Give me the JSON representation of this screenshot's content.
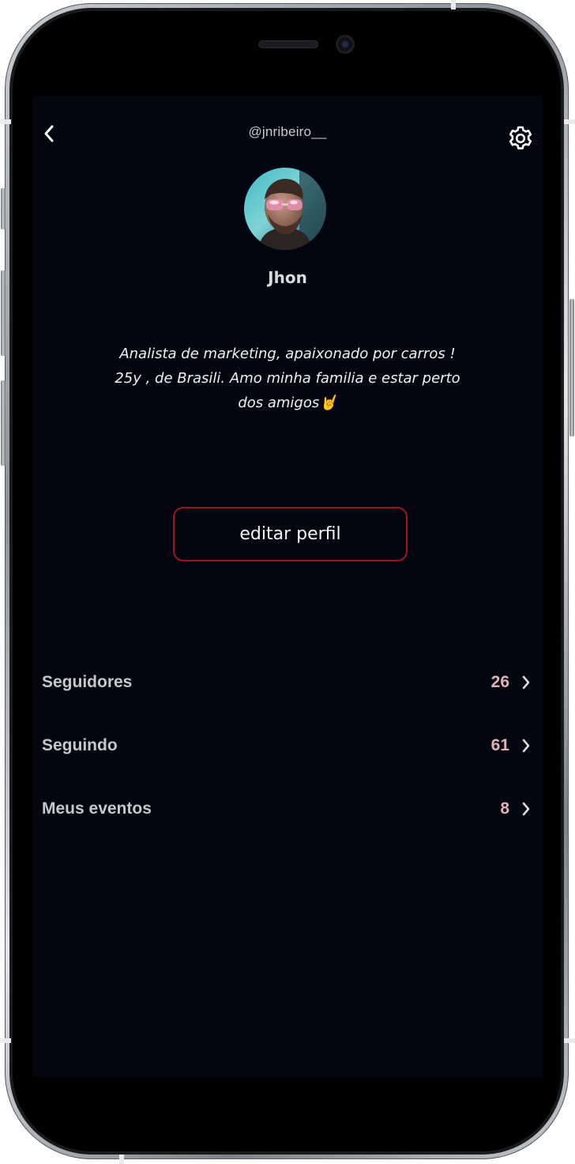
{
  "header": {
    "username": "@jnribeiro__",
    "back_icon": "chevron-left-icon",
    "settings_icon": "gear-icon"
  },
  "profile": {
    "name": "Jhon",
    "avatar_icon": "user-avatar",
    "bio_lines": [
      "Analista de marketing, apaixonado por carros !",
      "25y , de Brasili. Amo minha familia e estar perto",
      "dos amigos🤘"
    ],
    "edit_button_label": "editar perfil"
  },
  "stats": [
    {
      "label": "Seguidores",
      "count": "26"
    },
    {
      "label": "Seguindo",
      "count": "61"
    },
    {
      "label": "Meus eventos",
      "count": "8"
    }
  ],
  "colors": {
    "background": "#030510",
    "accent_border": "#a1141e",
    "count_text": "#e2b2b6",
    "label_text": "#c6c8ce"
  }
}
